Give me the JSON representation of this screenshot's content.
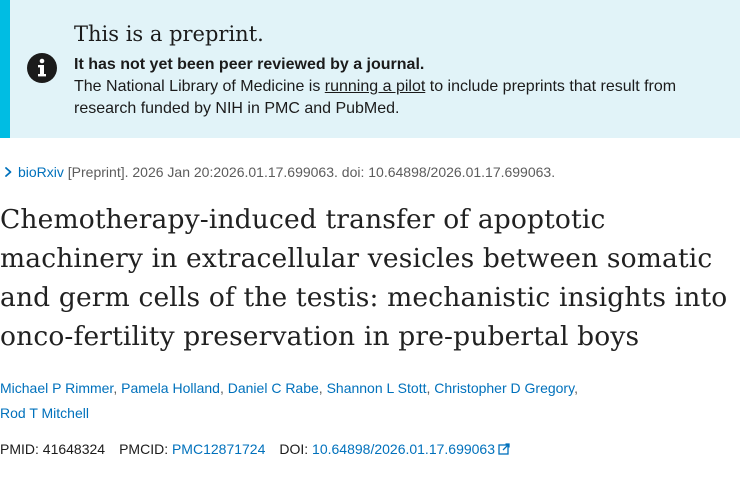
{
  "banner": {
    "icon": "info-icon",
    "heading": "This is a preprint.",
    "strong": "It has not yet been peer reviewed by a journal.",
    "body_before": "The National Library of Medicine is ",
    "link_text": "running a pilot",
    "body_after": " to include preprints that result from research funded by NIH in PMC and PubMed.",
    "background": "#e1f3f8",
    "accent": "#00bde3"
  },
  "citation": {
    "source_icon": "chevron-right-icon",
    "source": "bioRxiv",
    "text": " [Preprint]. 2026 Jan 20:2026.01.17.699063. doi: 10.64898/2026.01.17.699063."
  },
  "article": {
    "title": "Chemotherapy-induced transfer of apoptotic machinery in extracellular vesicles between somatic and germ cells of the testis: mechanistic insights into onco-fertility preservation in pre-pubertal boys"
  },
  "authors": [
    "Michael P Rimmer",
    "Pamela Holland",
    "Daniel C Rabe",
    "Shannon L Stott",
    "Christopher D Gregory",
    "Rod T Mitchell"
  ],
  "identifiers": {
    "pmid_label": "PMID: ",
    "pmid": "41648324",
    "pmcid_label": "PMCID: ",
    "pmcid": "PMC12871724",
    "doi_label": "DOI: ",
    "doi": "10.64898/2026.01.17.699063",
    "doi_icon": "external-link-icon",
    "link_color": "#0071bc"
  }
}
